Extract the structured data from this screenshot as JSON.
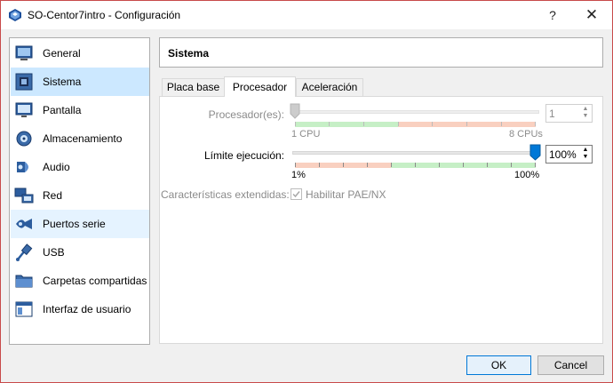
{
  "window": {
    "title": "SO-Centor7intro - Configuración",
    "help": "?",
    "close": "✕"
  },
  "sidebar": {
    "items": [
      {
        "label": "General",
        "icon": "general-icon"
      },
      {
        "label": "Sistema",
        "icon": "system-icon"
      },
      {
        "label": "Pantalla",
        "icon": "display-icon"
      },
      {
        "label": "Almacenamiento",
        "icon": "storage-icon"
      },
      {
        "label": "Audio",
        "icon": "audio-icon"
      },
      {
        "label": "Red",
        "icon": "network-icon"
      },
      {
        "label": "Puertos serie",
        "icon": "serial-ports-icon"
      },
      {
        "label": "USB",
        "icon": "usb-icon"
      },
      {
        "label": "Carpetas compartidas",
        "icon": "shared-folders-icon"
      },
      {
        "label": "Interfaz de usuario",
        "icon": "user-interface-icon"
      }
    ],
    "selected": "Sistema",
    "hovered": "Puertos serie"
  },
  "main": {
    "title": "Sistema",
    "tabs": [
      {
        "label": "Placa base"
      },
      {
        "label": "Procesador"
      },
      {
        "label": "Aceleración"
      }
    ],
    "active_tab": "Procesador",
    "processor": {
      "label": "Procesador(es):",
      "value": "1",
      "min_label": "1 CPU",
      "max_label": "8 CPUs",
      "min": 1,
      "max": 8,
      "enabled": false
    },
    "exec_cap": {
      "label": "Límite ejecución:",
      "value": "100%",
      "min_label": "1%",
      "max_label": "100%",
      "percent": 100
    },
    "extended": {
      "label": "Características extendidas:",
      "pae_label": "Habilitar PAE/NX",
      "pae_checked": true,
      "enabled": false
    }
  },
  "buttons": {
    "ok": "OK",
    "cancel": "Cancel"
  },
  "colors": {
    "selected_bg": "#cce8ff",
    "hover_bg": "#e5f3ff",
    "scale_green": "#c6efc6",
    "scale_red": "#f9d0c0",
    "accent": "#0078d7"
  }
}
